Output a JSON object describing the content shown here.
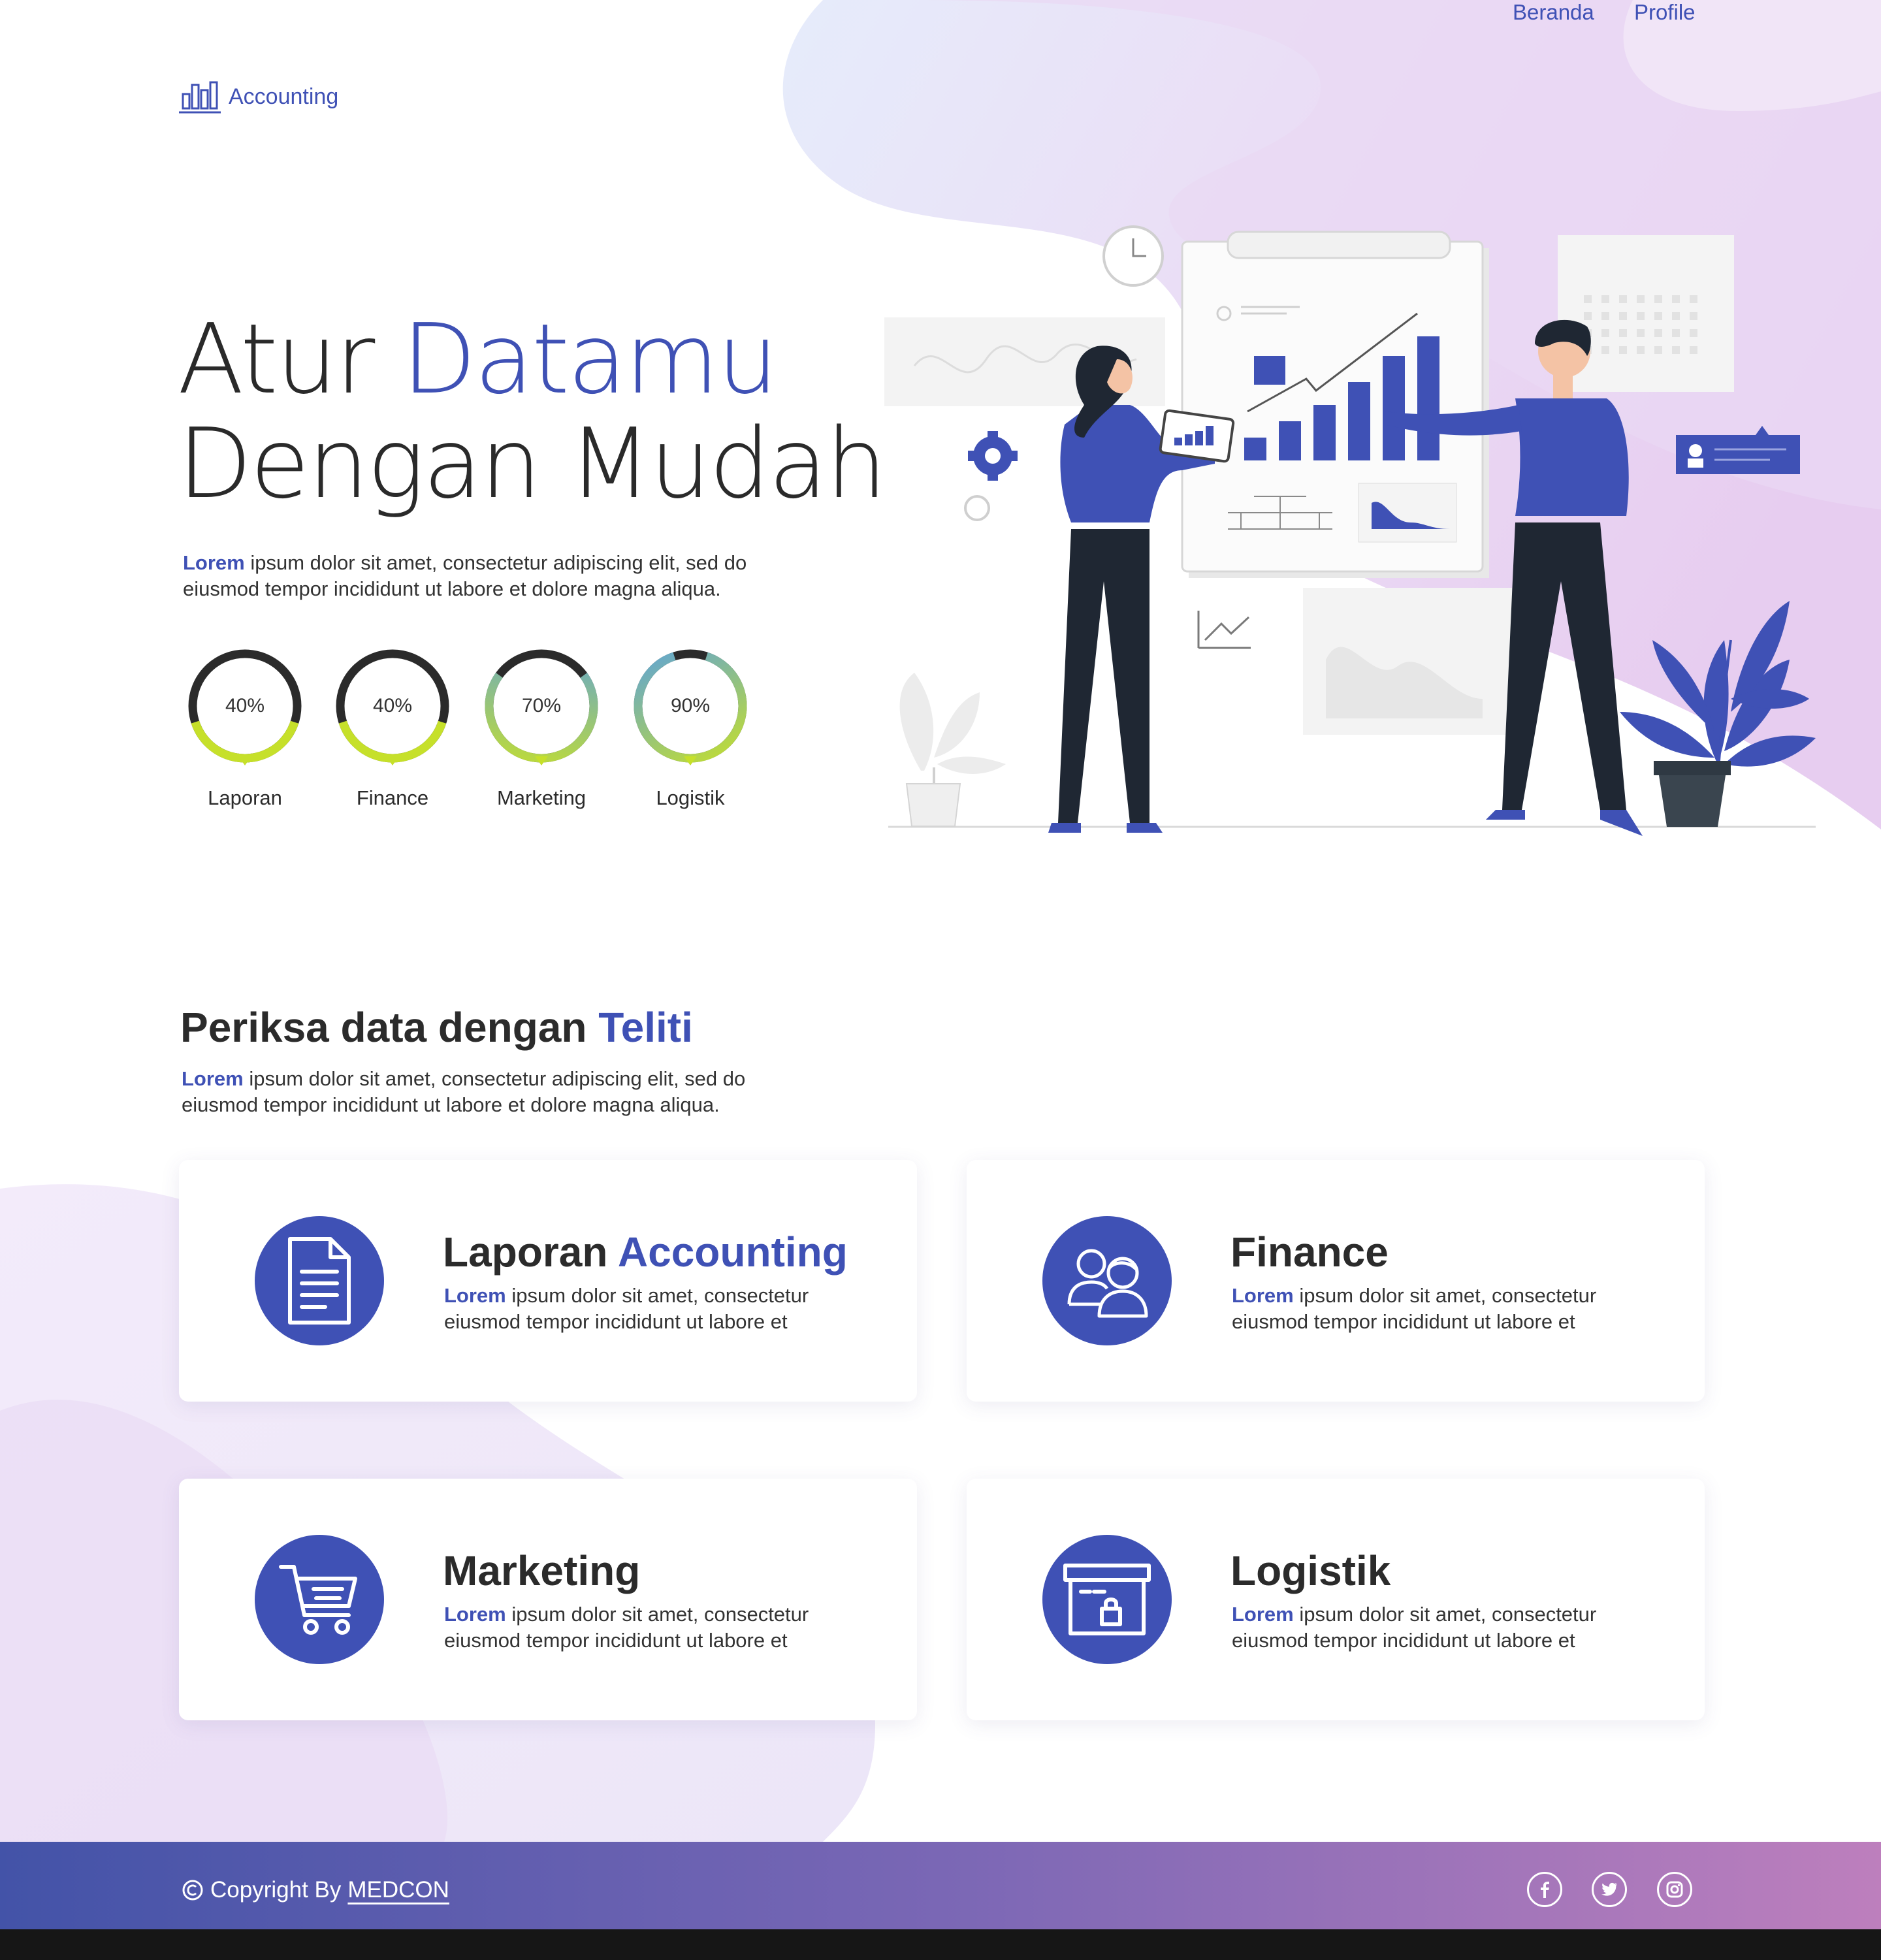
{
  "nav": {
    "brand": "Accounting",
    "links": [
      "Beranda",
      "Profile"
    ]
  },
  "hero": {
    "title_line1_a": "Atur ",
    "title_line1_b": "Datamu",
    "title_line2": "Dengan Mudah",
    "lead_bold": "Lorem",
    "lead_line1": " ipsum dolor sit amet, consectetur adipiscing elit, sed do",
    "lead_line2": "eiusmod tempor incididunt ut labore et dolore magna aliqua."
  },
  "stats": [
    {
      "label": "Laporan",
      "percent_text": "40%",
      "value": 0.4
    },
    {
      "label": "Finance",
      "percent_text": "40%",
      "value": 0.4
    },
    {
      "label": "Marketing",
      "percent_text": "70%",
      "value": 0.7
    },
    {
      "label": "Logistik",
      "percent_text": "90%",
      "value": 0.9
    }
  ],
  "section": {
    "title_a": "Periksa data dengan ",
    "title_b": "Teliti",
    "lead_bold": "Lorem",
    "lead_line1": " ipsum dolor sit amet, consectetur adipiscing elit, sed do",
    "lead_line2": "eiusmod tempor incididunt ut labore et dolore magna aliqua."
  },
  "cards": [
    {
      "title_a": "Laporan ",
      "title_b": "Accounting",
      "icon": "document-icon",
      "text_bold": "Lorem",
      "text_line1": " ipsum dolor sit amet, consectetur",
      "text_line2": "eiusmod tempor incididunt ut labore et"
    },
    {
      "title_a": "Finance",
      "title_b": "",
      "icon": "users-icon",
      "text_bold": "Lorem",
      "text_line1": " ipsum dolor sit amet, consectetur",
      "text_line2": "eiusmod tempor incididunt ut labore et"
    },
    {
      "title_a": "Marketing",
      "title_b": "",
      "icon": "shopping-cart-icon",
      "text_bold": "Lorem",
      "text_line1": " ipsum dolor sit amet, consectetur",
      "text_line2": "eiusmod tempor incididunt ut labore et"
    },
    {
      "title_a": "Logistik",
      "title_b": "",
      "icon": "locked-box-icon",
      "text_bold": "Lorem",
      "text_line1": " ipsum dolor sit amet, consectetur",
      "text_line2": "eiusmod tempor incididunt ut labore et"
    }
  ],
  "footer": {
    "copyright_prefix": "Copyright By ",
    "copyright_brand": "MEDCON",
    "social": [
      "facebook-icon",
      "twitter-icon",
      "instagram-icon"
    ]
  },
  "colors": {
    "accent": "#3f51b5",
    "ring_dark": "#2b2b2b",
    "ring_green": "#c6e02a",
    "ring_blue": "#5ea3d9",
    "footer_start": "#4353a8",
    "footer_end": "#bd7fbd"
  }
}
